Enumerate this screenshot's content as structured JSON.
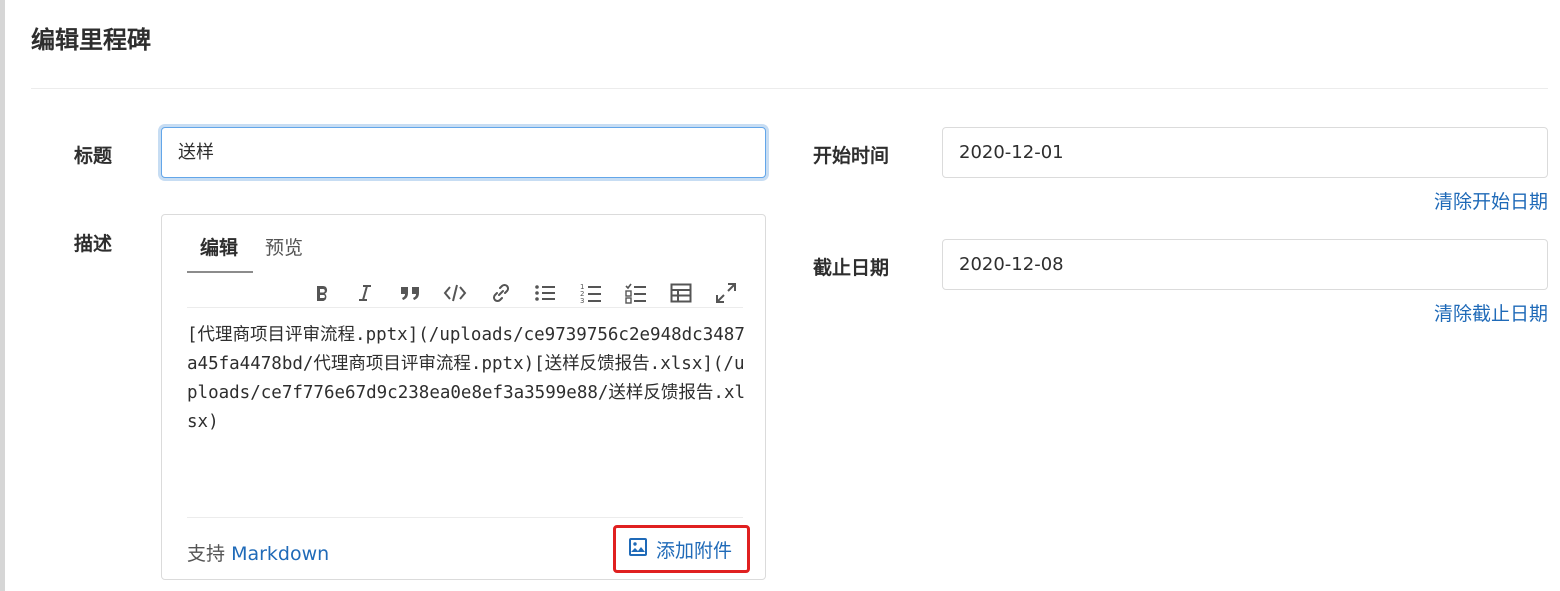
{
  "page": {
    "title": "编辑里程碑"
  },
  "form": {
    "title_label": "标题",
    "title_value": "送样",
    "description_label": "描述",
    "start_label": "开始时间",
    "start_value": "2020-12-01",
    "clear_start": "清除开始日期",
    "due_label": "截止日期",
    "due_value": "2020-12-08",
    "clear_due": "清除截止日期"
  },
  "editor": {
    "tabs": [
      {
        "label": "编辑",
        "active": true
      },
      {
        "label": "预览",
        "active": false
      }
    ],
    "toolbar_icons": [
      "bold-icon",
      "italic-icon",
      "quote-icon",
      "code-icon",
      "link-icon",
      "bullet-list-icon",
      "numbered-list-icon",
      "task-list-icon",
      "table-icon",
      "fullscreen-icon"
    ],
    "content": "[代理商项目评审流程.pptx](/uploads/ce9739756c2e948dc3487a45fa4478bd/代理商项目评审流程.pptx)[送样反馈报告.xlsx](/uploads/ce7f776e67d9c238ea0e8ef3a3599e88/送样反馈报告.xlsx)",
    "footer_prefix": "支持",
    "footer_link": "Markdown",
    "attach_label": "添加附件",
    "attach_icon": "image-icon"
  },
  "colors": {
    "link": "#1f6ab8",
    "highlight_border": "#e02020",
    "focus_border": "#63a6e9"
  }
}
